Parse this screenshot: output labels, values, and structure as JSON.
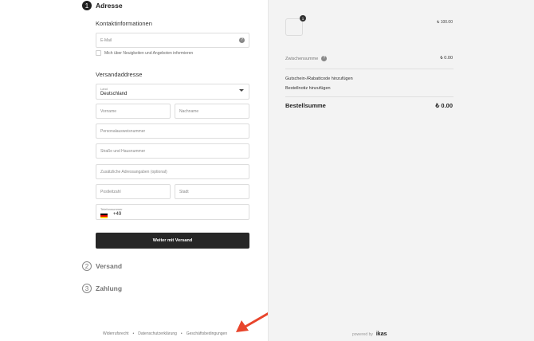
{
  "steps": [
    {
      "number": "1",
      "title": "Adresse",
      "active": true
    },
    {
      "number": "2",
      "title": "Versand",
      "active": false
    },
    {
      "number": "3",
      "title": "Zahlung",
      "active": false
    }
  ],
  "contact": {
    "title": "Kontaktinformationen",
    "email_placeholder": "E-Mail",
    "newsletter_label": "Mich über Neuigkeiten und Angeboten informieren"
  },
  "shipping": {
    "title": "Versandaddresse",
    "country_label": "Land",
    "country_value": "Deutschland",
    "first_name_placeholder": "Vorname",
    "last_name_placeholder": "Nachname",
    "id_placeholder": "Personalausweisnummer",
    "street_placeholder": "Straße und Hausnummer",
    "additional_placeholder": "Zusätzliche Adressangaben (optional)",
    "zip_placeholder": "Postleitzahl",
    "city_placeholder": "Stadt",
    "phone_label": "Telefonnummer",
    "phone_code": "+49"
  },
  "buttons": {
    "continue_label": "Weiter mit Versand"
  },
  "footer": {
    "links": [
      "Widerrufsrecht",
      "Datenschutzerklärung",
      "Geschäftsbedingungen"
    ],
    "separator": "•"
  },
  "summary": {
    "item_count": "1",
    "item_price": "₺ 100.00",
    "subtotal_label": "Zwischensumme",
    "subtotal_value": "₺ 0.00",
    "coupon_label": "Gutschein-/Rabattcode hinzufügen",
    "note_label": "Bestellnotiz hinzufügen",
    "total_label": "Bestellsumme",
    "total_value": "₺ 0.00"
  },
  "branding": {
    "powered_by": "powered by",
    "brand": "ikas"
  },
  "icons": {
    "help": "help-icon",
    "dropdown": "chevron-down-icon",
    "flag": "germany-flag-icon",
    "annotation": "red-arrow"
  },
  "colors": {
    "primary_button": "#262626",
    "summary_background": "#f3f3f3",
    "annotation_arrow": "#e8452c"
  }
}
